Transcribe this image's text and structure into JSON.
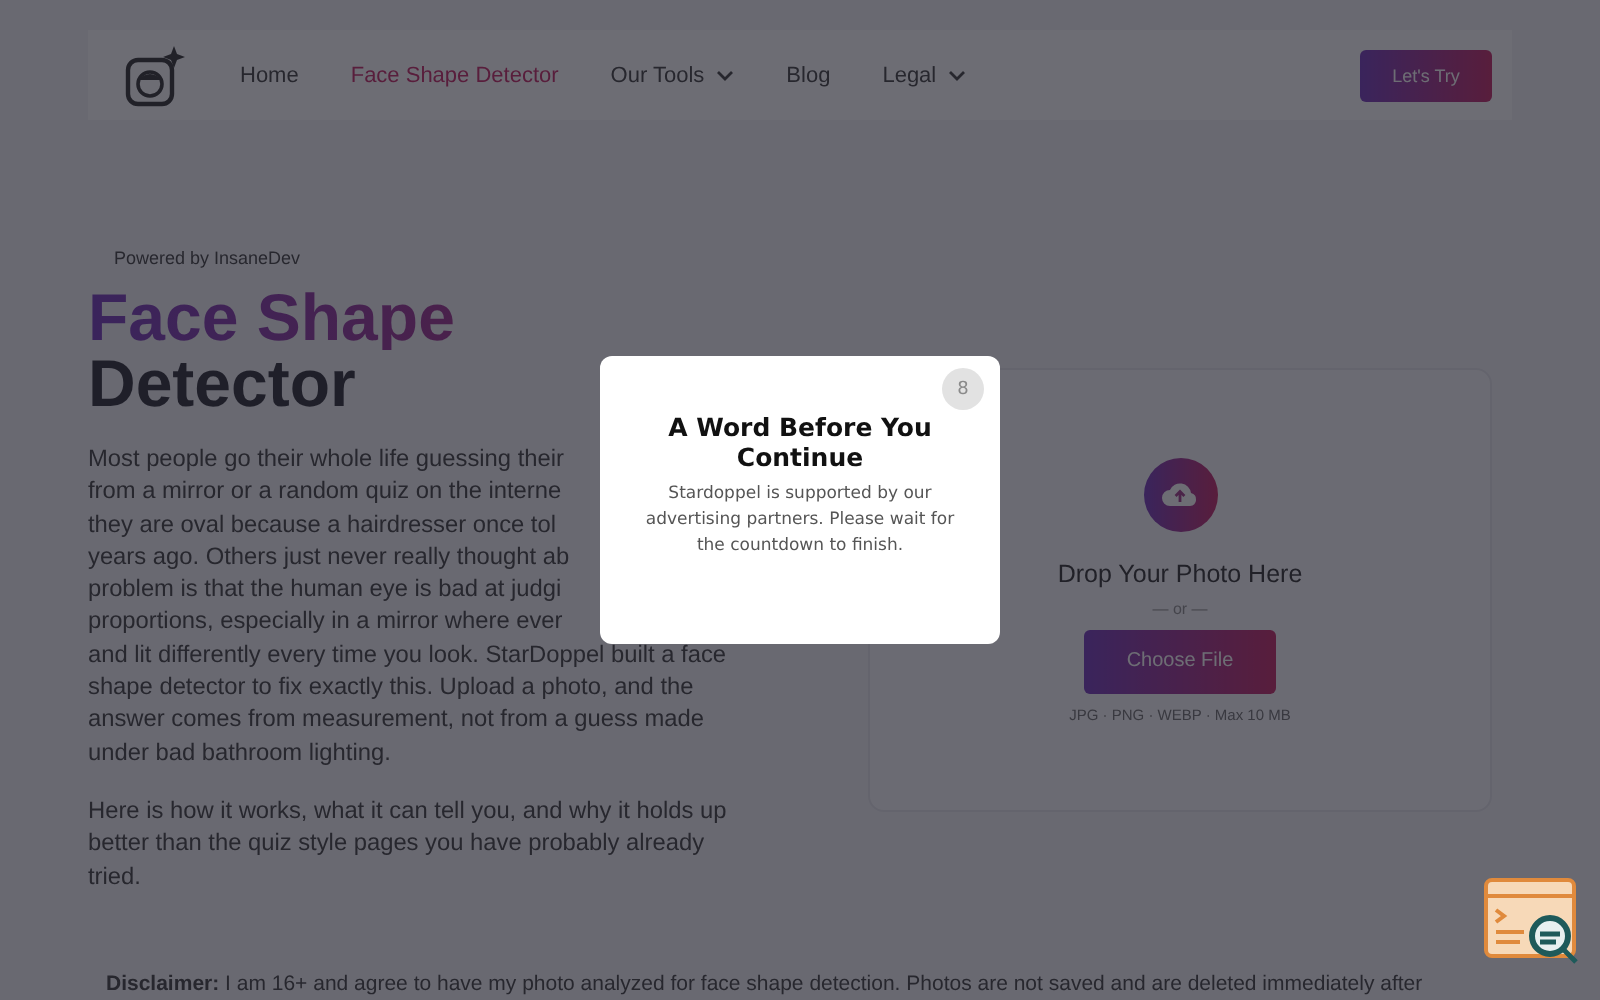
{
  "nav": {
    "links": [
      {
        "label": "Home",
        "selected": false,
        "dropdown": false
      },
      {
        "label": "Face Shape Detector",
        "selected": true,
        "dropdown": false
      },
      {
        "label": "Our Tools",
        "selected": false,
        "dropdown": true
      },
      {
        "label": "Blog",
        "selected": false,
        "dropdown": false
      },
      {
        "label": "Legal",
        "selected": false,
        "dropdown": true
      }
    ],
    "cta": "Let's Try"
  },
  "hero": {
    "tagline": "Powered by InsaneDev",
    "title_highlight": "Face Shape",
    "title_rest": "Detector",
    "paragraphs": [
      {
        "lines": [
          "Most people go their whole life guessing their",
          "from a mirror or a random quiz on the interne",
          "they are oval because a hairdresser once tol",
          "years ago. Others just never really thought ab",
          "problem is that the human eye is bad at judgi",
          "proportions, especially in a mirror where ever",
          "and lit differently every time you look. StarDoppel built a face",
          "shape detector to fix exactly this. Upload a photo, and the",
          "answer comes from measurement, not from a guess made",
          "under bad bathroom lighting."
        ]
      },
      {
        "lines": [
          "Here is how it works, what it can tell you, and why it holds up",
          "better than the quiz style pages you have probably already",
          "tried."
        ]
      }
    ]
  },
  "upload": {
    "heading": "Drop Your Photo Here",
    "separator": "— or —",
    "button": "Choose File",
    "hint": "JPG · PNG · WEBP · Max 10 MB"
  },
  "disclaimer": "**Disclaimer:** I am 16+ and agree to have my photo analyzed for face shape detection. Photos are not saved and are deleted immediately after",
  "modal": {
    "title": "A Word Before You Continue",
    "message": "Stardoppel is supported by our advertising partners. Please wait for the countdown to finish.",
    "countdown": "8"
  }
}
